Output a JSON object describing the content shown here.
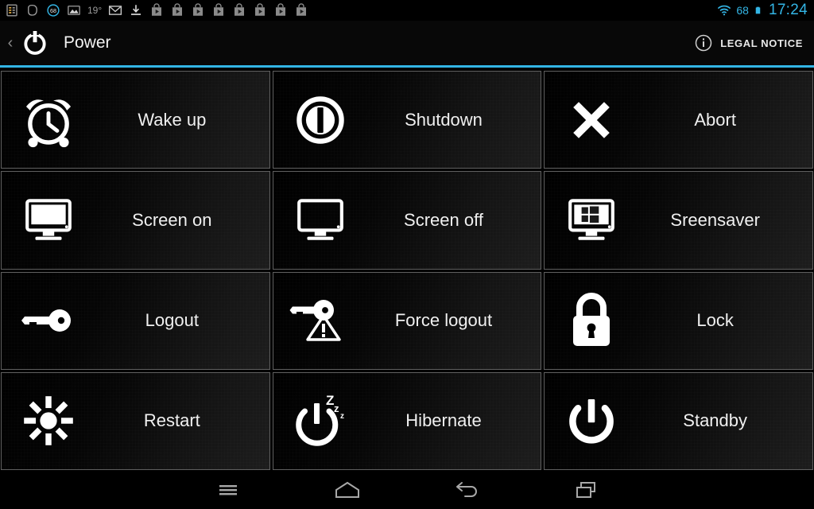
{
  "statusbar": {
    "left_icons": [
      {
        "name": "calendar-icon"
      },
      {
        "name": "rounded-shape-icon"
      },
      {
        "name": "battery-percent-badge-icon",
        "value": "68"
      },
      {
        "name": "gallery-image-icon"
      }
    ],
    "temperature": "19°",
    "mail_icon": "gmail-icon",
    "download_icon": "download-icon",
    "app_icon_count": 8,
    "app_icon": "play-store-bag-icon",
    "wifi_icon": "wifi-icon",
    "battery_level": "68",
    "battery_icon": "battery-icon",
    "clock": "17:24",
    "accent_color": "#33b5e5"
  },
  "actionbar": {
    "back_chevron": "‹",
    "app_icon": "power-icon",
    "title": "Power",
    "action_label": "LEGAL NOTICE",
    "action_icon": "info-circle-icon",
    "divider_color": "#33b5e5"
  },
  "grid": {
    "tiles": [
      {
        "id": "wake-up",
        "label": "Wake up",
        "icon": "alarm-clock-icon"
      },
      {
        "id": "shutdown",
        "label": "Shutdown",
        "icon": "power-filled-circle-icon"
      },
      {
        "id": "abort",
        "label": "Abort",
        "icon": "close-x-icon"
      },
      {
        "id": "screen-on",
        "label": "Screen on",
        "icon": "monitor-on-icon"
      },
      {
        "id": "screen-off",
        "label": "Screen off",
        "icon": "monitor-off-icon"
      },
      {
        "id": "screensaver",
        "label": "Sreensaver",
        "icon": "monitor-windows-logo-icon"
      },
      {
        "id": "logout",
        "label": "Logout",
        "icon": "key-icon"
      },
      {
        "id": "force-logout",
        "label": "Force logout",
        "icon": "key-warning-icon"
      },
      {
        "id": "lock",
        "label": "Lock",
        "icon": "padlock-closed-icon"
      },
      {
        "id": "restart",
        "label": "Restart",
        "icon": "sunburst-restart-icon"
      },
      {
        "id": "hibernate",
        "label": "Hibernate",
        "icon": "power-zzz-icon"
      },
      {
        "id": "standby",
        "label": "Standby",
        "icon": "power-symbol-icon"
      }
    ]
  },
  "navbar": {
    "buttons": [
      {
        "id": "menu",
        "icon": "menu-hamburger-icon"
      },
      {
        "id": "home",
        "icon": "home-icon"
      },
      {
        "id": "back",
        "icon": "back-arrow-icon"
      },
      {
        "id": "recents",
        "icon": "recent-apps-icon"
      }
    ]
  }
}
